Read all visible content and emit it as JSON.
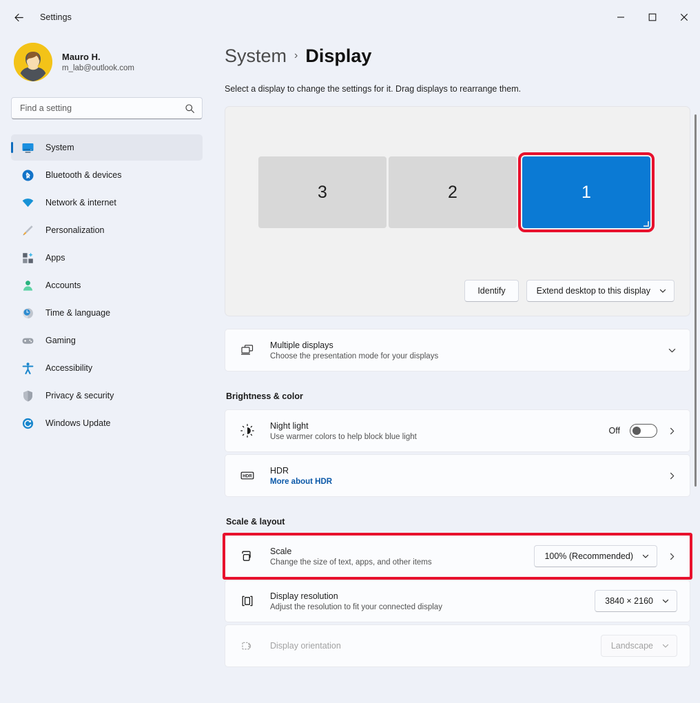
{
  "window": {
    "title": "Settings",
    "back_icon": "back-arrow-icon",
    "minimize_label": "Minimize",
    "maximize_label": "Maximize",
    "close_label": "Close"
  },
  "account": {
    "name": "Mauro H.",
    "email": "m_lab@outlook.com"
  },
  "search": {
    "placeholder": "Find a setting",
    "value": "",
    "icon": "search-icon"
  },
  "sidebar": {
    "items": [
      {
        "label": "System",
        "icon": "monitor-icon",
        "active": true
      },
      {
        "label": "Bluetooth & devices",
        "icon": "bluetooth-icon",
        "active": false
      },
      {
        "label": "Network & internet",
        "icon": "wifi-icon",
        "active": false
      },
      {
        "label": "Personalization",
        "icon": "paintbrush-icon",
        "active": false
      },
      {
        "label": "Apps",
        "icon": "apps-grid-icon",
        "active": false
      },
      {
        "label": "Accounts",
        "icon": "person-icon",
        "active": false
      },
      {
        "label": "Time & language",
        "icon": "clock-icon",
        "active": false
      },
      {
        "label": "Gaming",
        "icon": "gamepad-icon",
        "active": false
      },
      {
        "label": "Accessibility",
        "icon": "accessibility-icon",
        "active": false
      },
      {
        "label": "Privacy & security",
        "icon": "shield-icon",
        "active": false
      },
      {
        "label": "Windows Update",
        "icon": "update-refresh-icon",
        "active": false
      }
    ]
  },
  "main": {
    "breadcrumb": {
      "parent": "System",
      "separator": "›",
      "current": "Display"
    },
    "subtitle": "Select a display to change the settings for it. Drag displays to rearrange them.",
    "arrangement": {
      "monitors": [
        {
          "label": "3",
          "selected": false
        },
        {
          "label": "2",
          "selected": false
        },
        {
          "label": "1",
          "selected": true
        }
      ],
      "identify_button": "Identify",
      "mode_dropdown": {
        "value": "Extend desktop to this display",
        "chevron": "chevron-down-icon"
      }
    },
    "multiple_displays": {
      "title": "Multiple displays",
      "subtitle": "Choose the presentation mode for your displays",
      "icon": "multiple-displays-icon",
      "expander": "chevron-down-icon"
    },
    "sections": [
      {
        "heading": "Brightness & color",
        "rows": [
          {
            "title": "Night light",
            "subtitle": "Use warmer colors to help block blue light",
            "icon": "night-light-sun-icon",
            "toggle_label": "Off",
            "toggle_state": "off",
            "chevron": "chevron-right-icon"
          },
          {
            "title": "HDR",
            "subtitle": "More about HDR",
            "subtitle_is_link": true,
            "icon": "hdr-badge-icon",
            "chevron": "chevron-right-icon"
          }
        ]
      },
      {
        "heading": "Scale & layout",
        "rows": [
          {
            "title": "Scale",
            "subtitle": "Change the size of text, apps, and other items",
            "icon": "scale-icon",
            "dropdown_value": "100% (Recommended)",
            "chevron": "chevron-right-icon",
            "annotated": true
          },
          {
            "title": "Display resolution",
            "subtitle": "Adjust the resolution to fit your connected display",
            "icon": "display-resolution-icon",
            "dropdown_value": "3840 × 2160"
          },
          {
            "title": "Display orientation",
            "subtitle": "",
            "icon": "display-orientation-icon",
            "dropdown_value": "Landscape",
            "disabled": true
          }
        ]
      }
    ]
  },
  "colors": {
    "accent": "#0f6cbd",
    "selected_monitor": "#0b7ad4",
    "annotation": "#e8112d",
    "link": "#0a58a8",
    "page_bg": "#eef1f8",
    "card_bg": "#fbfcfe"
  }
}
